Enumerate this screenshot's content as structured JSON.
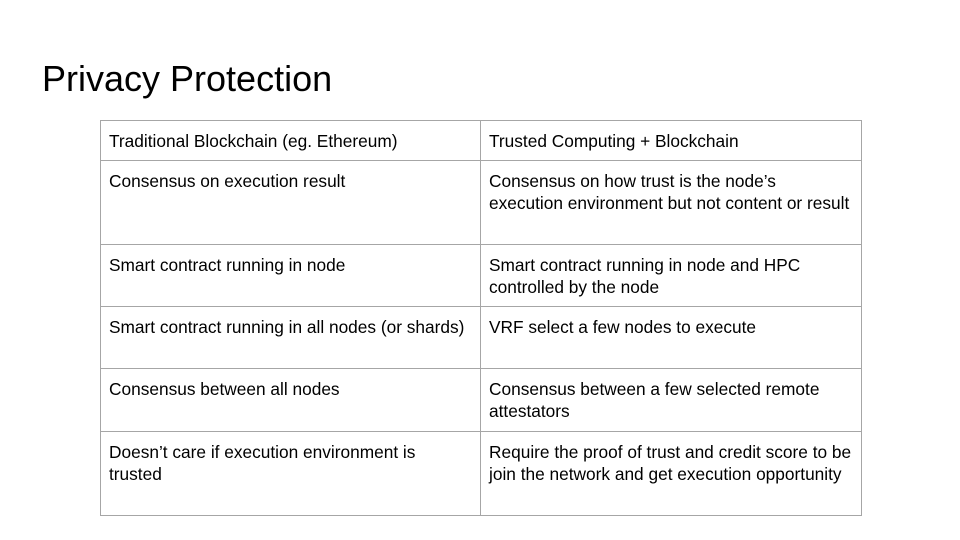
{
  "slide": {
    "title": "Privacy Protection"
  },
  "table": {
    "rows": [
      {
        "left": "Traditional Blockchain (eg. Ethereum)",
        "right": "Trusted Computing + Blockchain"
      },
      {
        "left": "Consensus on execution result",
        "right": "Consensus on how trust is the node’s execution environment but not content or result"
      },
      {
        "left": "Smart contract running in node",
        "right": "Smart contract running in node and HPC controlled by the node"
      },
      {
        "left": "Smart contract running in all nodes (or shards)",
        "right": "VRF select a few nodes to execute"
      },
      {
        "left": "Consensus between all nodes",
        "right": "Consensus between a few selected remote attestators"
      },
      {
        "left": "Doesn’t care if execution environment is trusted",
        "right": "Require the proof of trust and credit score to be join the network and get execution opportunity"
      }
    ]
  }
}
